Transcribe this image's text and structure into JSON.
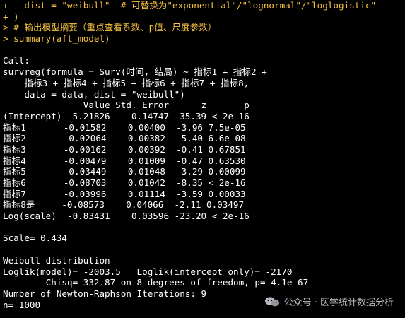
{
  "colors": {
    "background": "#000000",
    "input_text": "#F4C242",
    "output_text": "#FFFFFF",
    "watermark_text": "#BFC3C8"
  },
  "console": {
    "lines": [
      {
        "kind": "input",
        "text": "+   dist = \"weibull\"  # 可替换为\"exponential\"/\"lognormal\"/\"loglogistic\""
      },
      {
        "kind": "input",
        "text": "+ )"
      },
      {
        "kind": "input",
        "text": "> # 输出模型摘要（重点查看系数、p值、尺度参数）"
      },
      {
        "kind": "input",
        "text": "> summary(aft_model)"
      },
      {
        "kind": "blank",
        "text": ""
      },
      {
        "kind": "output",
        "text": "Call:"
      },
      {
        "kind": "output",
        "text": "survreg(formula = Surv(时间, 结局) ~ 指标1 + 指标2 +"
      },
      {
        "kind": "output",
        "text": "    指标3 + 指标4 + 指标5 + 指标6 + 指标7 + 指标8,"
      },
      {
        "kind": "output",
        "text": "    data = data, dist = \"weibull\")"
      },
      {
        "kind": "output",
        "text": "               Value Std. Error      z       p"
      },
      {
        "kind": "output",
        "text": "(Intercept)  5.21826    0.14747  35.39 < 2e-16"
      },
      {
        "kind": "output",
        "text": "指标1       -0.01582    0.00400  -3.96 7.5e-05"
      },
      {
        "kind": "output",
        "text": "指标2       -0.02064    0.00382  -5.40 6.6e-08"
      },
      {
        "kind": "output",
        "text": "指标3       -0.00162    0.00392  -0.41 0.67851"
      },
      {
        "kind": "output",
        "text": "指标4       -0.00479    0.01009  -0.47 0.63530"
      },
      {
        "kind": "output",
        "text": "指标5       -0.03449    0.01048  -3.29 0.00099"
      },
      {
        "kind": "output",
        "text": "指标6       -0.08703    0.01042  -8.35 < 2e-16"
      },
      {
        "kind": "output",
        "text": "指标7       -0.03996    0.01114  -3.59 0.00033"
      },
      {
        "kind": "output",
        "text": "指标8是     -0.08573    0.04066  -2.11 0.03497"
      },
      {
        "kind": "output",
        "text": "Log(scale)  -0.83431    0.03596 -23.20 < 2e-16"
      },
      {
        "kind": "blank",
        "text": ""
      },
      {
        "kind": "output",
        "text": "Scale= 0.434"
      },
      {
        "kind": "blank",
        "text": ""
      },
      {
        "kind": "output",
        "text": "Weibull distribution"
      },
      {
        "kind": "output",
        "text": "Loglik(model)= -2003.5   Loglik(intercept only)= -2170"
      },
      {
        "kind": "output",
        "text": "        Chisq= 332.87 on 8 degrees of freedom, p= 4.1e-67"
      },
      {
        "kind": "output",
        "text": "Number of Newton-Raphson Iterations: 9"
      },
      {
        "kind": "output",
        "text": "n= 1000"
      }
    ]
  },
  "watermark": {
    "icon": "wechat-bubble-icon",
    "text": "公众号 · 医学统计数据分析"
  }
}
